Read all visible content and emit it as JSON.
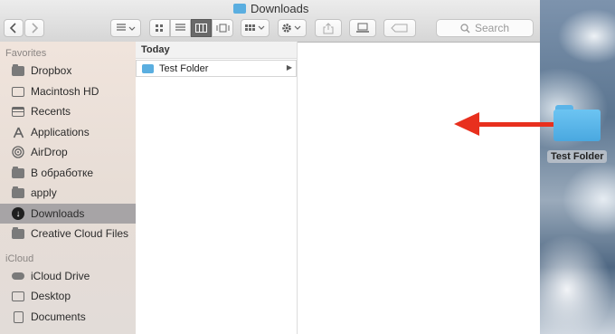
{
  "window": {
    "title": "Downloads"
  },
  "toolbar": {
    "back_icon": "chevron-left",
    "forward_icon": "chevron-right",
    "search_placeholder": "Search"
  },
  "sidebar": {
    "favorites_header": "Favorites",
    "favorites": [
      {
        "label": "Dropbox",
        "icon": "folder"
      },
      {
        "label": "Macintosh HD",
        "icon": "hard-drive"
      },
      {
        "label": "Recents",
        "icon": "recents"
      },
      {
        "label": "Applications",
        "icon": "applications"
      },
      {
        "label": "AirDrop",
        "icon": "airdrop"
      },
      {
        "label": "В обработке",
        "icon": "folder"
      },
      {
        "label": "apply",
        "icon": "folder"
      },
      {
        "label": "Downloads",
        "icon": "downloads",
        "selected": true
      },
      {
        "label": "Creative Cloud Files",
        "icon": "folder"
      }
    ],
    "icloud_header": "iCloud",
    "icloud": [
      {
        "label": "iCloud Drive",
        "icon": "cloud"
      },
      {
        "label": "Desktop",
        "icon": "desktop"
      },
      {
        "label": "Documents",
        "icon": "documents"
      }
    ]
  },
  "column": {
    "header": "Today",
    "items": [
      {
        "label": "Test Folder"
      }
    ]
  },
  "desktop": {
    "folder_label": "Test Folder"
  },
  "colors": {
    "arrow": "#e8301e",
    "folder_blue": "#5aaee0",
    "selected_row": "#a7a4a6"
  }
}
